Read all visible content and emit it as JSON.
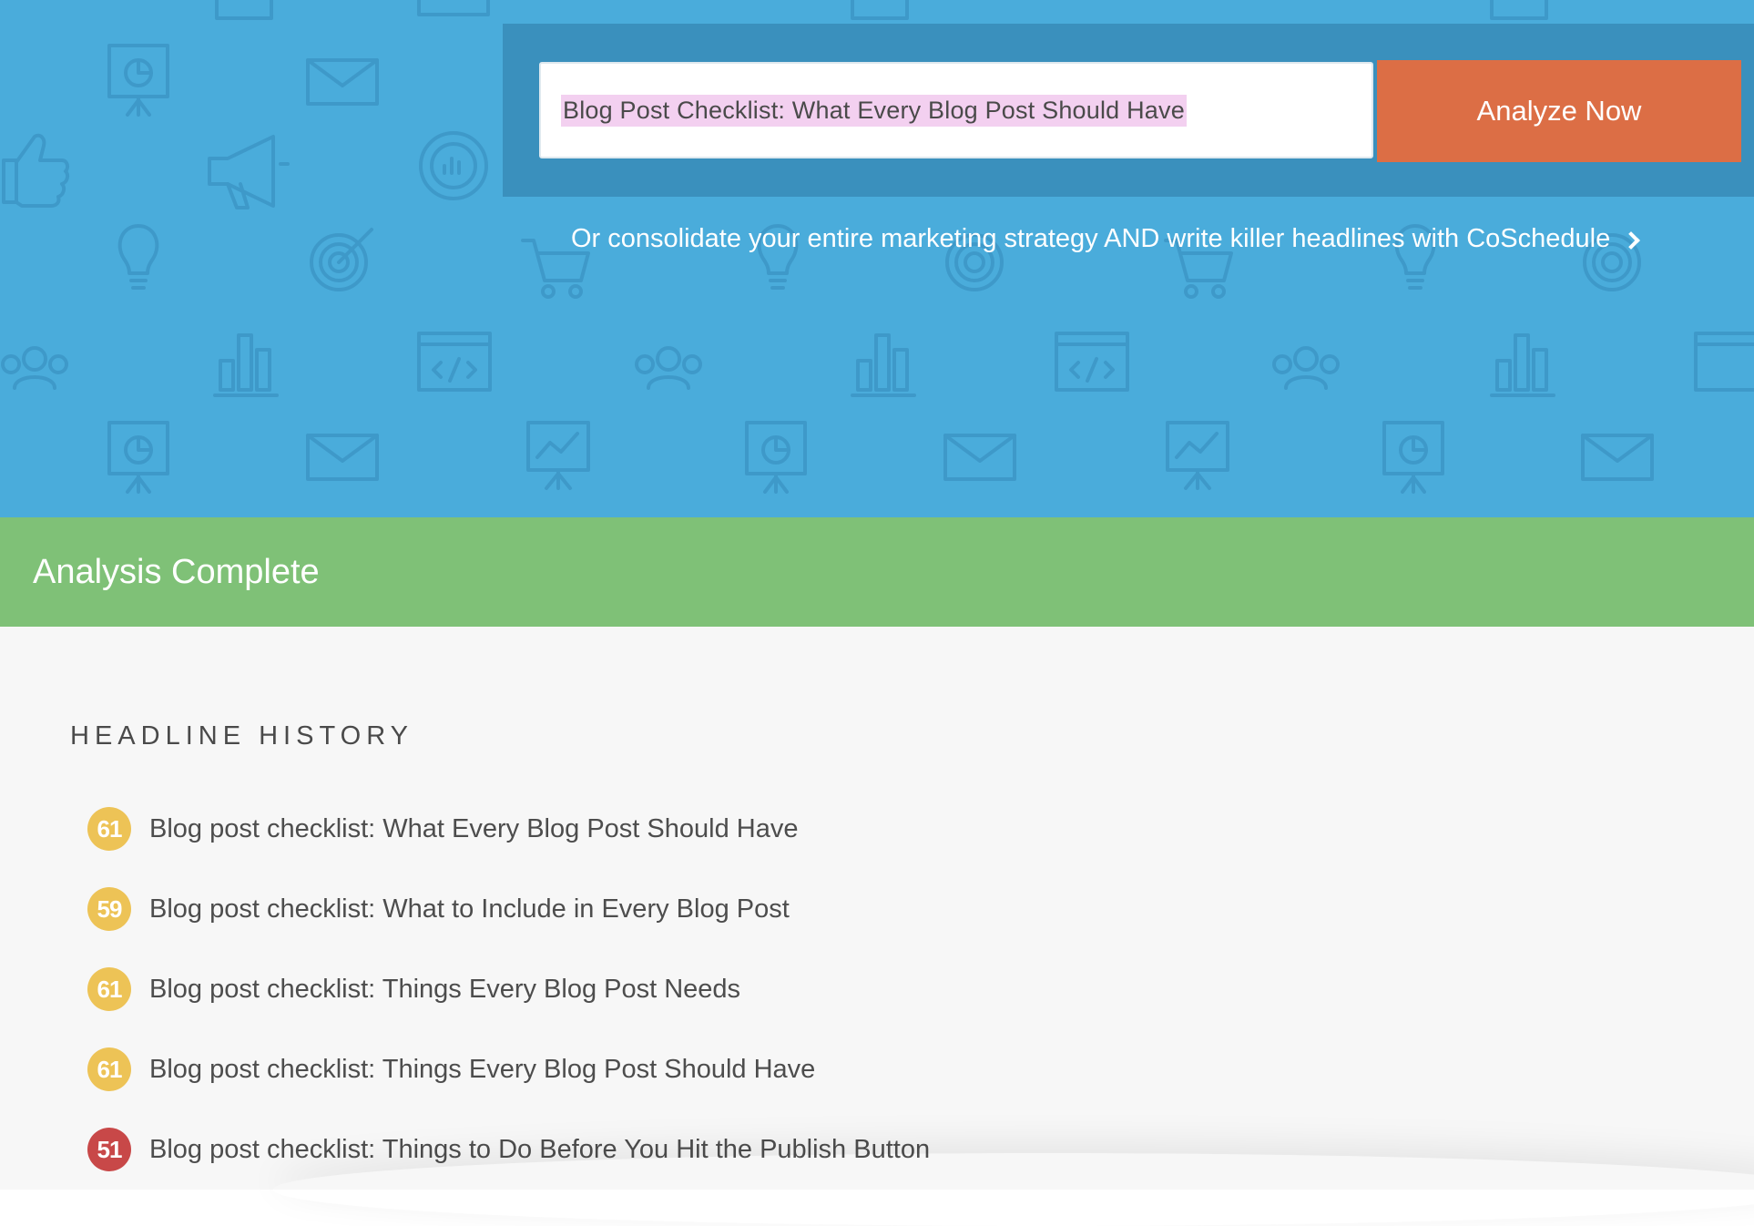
{
  "search": {
    "value": "Blog Post Checklist: What Every Blog Post Should Have",
    "button_label": "Analyze Now"
  },
  "promo": {
    "text": "Or consolidate your entire marketing strategy AND write killer headlines with CoSchedule"
  },
  "status": {
    "text": "Analysis Complete"
  },
  "history": {
    "title": "HEADLINE HISTORY",
    "items": [
      {
        "score": "61",
        "level": "mid",
        "text": "Blog post checklist: What Every Blog Post Should Have"
      },
      {
        "score": "59",
        "level": "mid",
        "text": "Blog post checklist: What to Include in Every Blog Post"
      },
      {
        "score": "61",
        "level": "mid",
        "text": "Blog post checklist: Things Every Blog Post Needs"
      },
      {
        "score": "61",
        "level": "mid",
        "text": "Blog post checklist: Things Every Blog Post Should Have"
      },
      {
        "score": "51",
        "level": "low",
        "text": "Blog post checklist: Things to Do Before You Hit the Publish Button"
      }
    ]
  },
  "colors": {
    "hero_bg": "#4aacdb",
    "panel_bg": "#3a90bd",
    "button_bg": "#dc6e45",
    "status_bg": "#7fc177",
    "score_mid": "#edc356",
    "score_low": "#c84848",
    "highlight": "#f3d0f0"
  }
}
